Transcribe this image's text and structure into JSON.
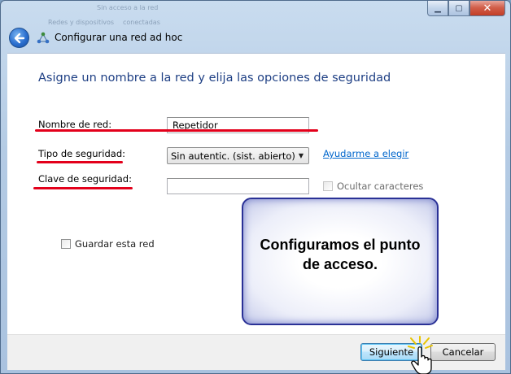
{
  "window": {
    "title": "Configurar una red ad hoc",
    "icon": "network-adhoc-icon",
    "controls": {
      "minimize": "minimize-icon",
      "maximize": "maximize-icon",
      "close": "close-icon"
    }
  },
  "background_ghost_text": [
    "Sin acceso a la red",
    "Redes y dispositivos",
    "conectadas"
  ],
  "page": {
    "heading": "Asigne un nombre a la red y elija las opciones de seguridad"
  },
  "form": {
    "network_name_label": "Nombre de red:",
    "network_name_value": "Repetidor",
    "security_type_label": "Tipo de seguridad:",
    "security_type_value": "Sin autentic. (sist. abierto)",
    "help_link": "Ayudarme a elegir",
    "security_key_label": "Clave de seguridad:",
    "security_key_value": "",
    "hide_characters_label": "Ocultar caracteres",
    "save_network_label": "Guardar esta red"
  },
  "annotation": {
    "text": "Configuramos el punto de acceso.",
    "highlight_color": "#e3001b",
    "box_border_color": "#2a3196"
  },
  "footer": {
    "next_label": "Siguiente",
    "cancel_label": "Cancelar"
  },
  "colors": {
    "heading": "#1e3f84",
    "link": "#0066cc"
  }
}
